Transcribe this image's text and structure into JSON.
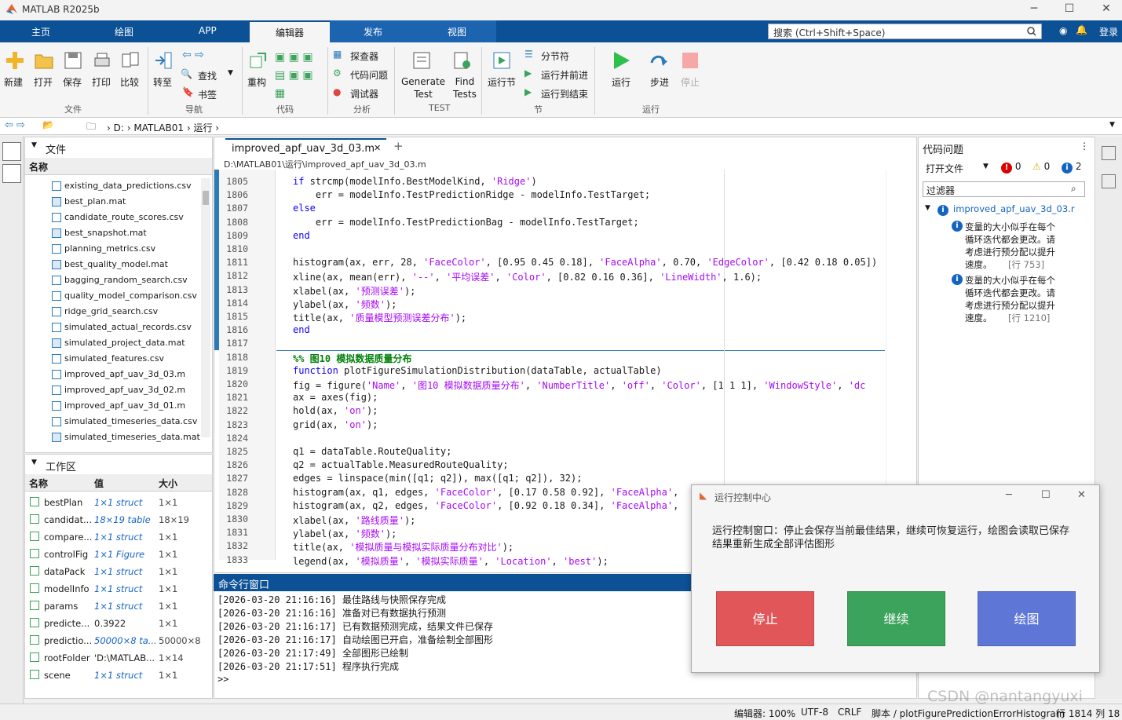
{
  "window": {
    "title": "MATLAB R2025b"
  },
  "tabs": [
    "主页",
    "绘图",
    "APP",
    "编辑器",
    "发布",
    "视图"
  ],
  "search": {
    "placeholder": "搜索 (Ctrl+Shift+Space)",
    "login": "登录"
  },
  "ribbon": {
    "file": {
      "new": "新建",
      "open": "打开",
      "save": "保存",
      "print": "打印",
      "compare": "比较",
      "group": "文件"
    },
    "nav": {
      "goto": "转至",
      "find": "查找",
      "bookmark": "书签",
      "group": "导航"
    },
    "code": {
      "refactor": "重构",
      "group": "代码"
    },
    "analyze": {
      "explorer": "探查器",
      "issues": "代码问题",
      "debugger": "调试器",
      "group": "分析"
    },
    "test": {
      "gen1": "Generate",
      "gen2": "Test",
      "find1": "Find",
      "find2": "Tests",
      "group": "TEST"
    },
    "section": {
      "run_section": "运行节",
      "break": "分节符",
      "run_advance": "运行并前进",
      "run_to_end": "运行到结束",
      "group": "节"
    },
    "run": {
      "run": "运行",
      "step": "步进",
      "stop": "停止",
      "group": "运行"
    }
  },
  "address": {
    "drive": "D:",
    "folder1": "MATLAB01",
    "folder2": "运行"
  },
  "files_panel": {
    "title": "文件",
    "col_name": "名称",
    "items": [
      "existing_data_predictions.csv",
      "best_plan.mat",
      "candidate_route_scores.csv",
      "best_snapshot.mat",
      "planning_metrics.csv",
      "best_quality_model.mat",
      "bagging_random_search.csv",
      "quality_model_comparison.csv",
      "ridge_grid_search.csv",
      "simulated_actual_records.csv",
      "simulated_project_data.mat",
      "simulated_features.csv",
      "improved_apf_uav_3d_03.m",
      "improved_apf_uav_3d_02.m",
      "improved_apf_uav_3d_01.m",
      "simulated_timeseries_data.csv",
      "simulated_timeseries_data.mat"
    ]
  },
  "workspace": {
    "title": "工作区",
    "col_name": "名称",
    "col_value": "值",
    "col_size": "大小",
    "rows": [
      {
        "name": "bestPlan",
        "value": "1×1 struct",
        "size": "1×1"
      },
      {
        "name": "candidat...",
        "value": "18×19 table",
        "size": "18×19"
      },
      {
        "name": "compare...",
        "value": "1×1 struct",
        "size": "1×1"
      },
      {
        "name": "controlFig",
        "value": "1×1 Figure",
        "size": "1×1"
      },
      {
        "name": "dataPack",
        "value": "1×1 struct",
        "size": "1×1"
      },
      {
        "name": "modelInfo",
        "value": "1×1 struct",
        "size": "1×1"
      },
      {
        "name": "params",
        "value": "1×1 struct",
        "size": "1×1"
      },
      {
        "name": "predicte...",
        "value": "0.3922",
        "size": "1×1"
      },
      {
        "name": "predictio...",
        "value": "50000×8 ta...",
        "size": "50000×8"
      },
      {
        "name": "rootFolder",
        "value": "'D:\\MATLAB...",
        "size": "1×14"
      },
      {
        "name": "scene",
        "value": "1×1 struct",
        "size": "1×1"
      }
    ]
  },
  "editor": {
    "tab": "improved_apf_uav_3d_03.m",
    "path": "D:\\MATLAB01\\运行\\improved_apf_uav_3d_03.m",
    "lines": [
      {
        "n": "1805",
        "html": "<span class=\"kw\">if</span> strcmp(modelInfo.BestModelKind, <span class=\"st\">'Ridge'</span>)"
      },
      {
        "n": "1806",
        "html": "    err = modelInfo.TestPredictionRidge - modelInfo.TestTarget;"
      },
      {
        "n": "1807",
        "html": "<span class=\"kw\">else</span>"
      },
      {
        "n": "1808",
        "html": "    err = modelInfo.TestPredictionBag - modelInfo.TestTarget;"
      },
      {
        "n": "1809",
        "html": "<span class=\"kw\">end</span>"
      },
      {
        "n": "1810",
        "html": ""
      },
      {
        "n": "1811",
        "html": "histogram(ax, err, 28, <span class=\"st\">'FaceColor'</span>, [0.95 0.45 0.18], <span class=\"st\">'FaceAlpha'</span>, 0.70, <span class=\"st\">'EdgeColor'</span>, [0.42 0.18 0.05])"
      },
      {
        "n": "1812",
        "html": "xline(ax, mean(err), <span class=\"st\">'--'</span>, <span class=\"st\">'平均误差'</span>, <span class=\"st\">'Color'</span>, [0.82 0.16 0.36], <span class=\"st\">'LineWidth'</span>, 1.6);"
      },
      {
        "n": "1813",
        "html": "xlabel(ax, <span class=\"st\">'预测误差'</span>);"
      },
      {
        "n": "1814",
        "html": "ylabel(ax, <span class=\"st\">'频数'</span>);"
      },
      {
        "n": "1815",
        "html": "title(ax, <span class=\"st\">'质量模型预测误差分布'</span>);"
      },
      {
        "n": "1816",
        "html": "<span class=\"kw\">end</span>"
      },
      {
        "n": "1817",
        "html": ""
      },
      {
        "n": "1818",
        "html": "<span class=\"cm\">%% 图10 模拟数据质量分布</span>"
      },
      {
        "n": "1819",
        "html": "<span class=\"kw\">function</span> plotFigureSimulationDistribution(dataTable, actualTable)"
      },
      {
        "n": "1820",
        "html": "fig = figure(<span class=\"st\">'Name'</span>, <span class=\"st\">'图10 模拟数据质量分布'</span>, <span class=\"st\">'NumberTitle'</span>, <span class=\"st\">'off'</span>, <span class=\"st\">'Color'</span>, [1 1 1], <span class=\"st\">'WindowStyle'</span>, <span class=\"st\">'dc</span>"
      },
      {
        "n": "1821",
        "html": "ax = axes(fig);"
      },
      {
        "n": "1822",
        "html": "hold(ax, <span class=\"st\">'on'</span>);"
      },
      {
        "n": "1823",
        "html": "grid(ax, <span class=\"st\">'on'</span>);"
      },
      {
        "n": "1824",
        "html": ""
      },
      {
        "n": "1825",
        "html": "q1 = dataTable.RouteQuality;"
      },
      {
        "n": "1826",
        "html": "q2 = actualTable.MeasuredRouteQuality;"
      },
      {
        "n": "1827",
        "html": "edges = linspace(min([q1; q2]), max([q1; q2]), 32);"
      },
      {
        "n": "1828",
        "html": "histogram(ax, q1, edges, <span class=\"st\">'FaceColor'</span>, [0.17 0.58 0.92], <span class=\"st\">'FaceAlpha'</span>,"
      },
      {
        "n": "1829",
        "html": "histogram(ax, q2, edges, <span class=\"st\">'FaceColor'</span>, [0.92 0.18 0.34], <span class=\"st\">'FaceAlpha'</span>,"
      },
      {
        "n": "1830",
        "html": "xlabel(ax, <span class=\"st\">'路线质量'</span>);"
      },
      {
        "n": "1831",
        "html": "ylabel(ax, <span class=\"st\">'频数'</span>);"
      },
      {
        "n": "1832",
        "html": "title(ax, <span class=\"st\">'模拟质量与模拟实际质量分布对比'</span>);"
      },
      {
        "n": "1833",
        "html": "legend(ax, <span class=\"st\">'模拟质量'</span>, <span class=\"st\">'模拟实际质量'</span>, <span class=\"st\">'Location'</span>, <span class=\"st\">'best'</span>);"
      }
    ]
  },
  "command_window": {
    "title": "命令行窗口",
    "lines": [
      "[2026-03-20 21:16:16] 最佳路线与快照保存完成",
      "[2026-03-20 21:16:16] 准备对已有数据执行预测",
      "[2026-03-20 21:16:17] 已有数据预测完成，结果文件已保存",
      "[2026-03-20 21:16:17] 自动绘图已开启，准备绘制全部图形",
      "[2026-03-20 21:17:49] 全部图形已绘制",
      "[2026-03-20 21:17:51] 程序执行完成"
    ],
    "prompt": ">>"
  },
  "issues_panel": {
    "title": "代码问题",
    "scope": "打开文件",
    "err_count": "0",
    "warn_count": "0",
    "info_count": "2",
    "filter_placeholder": "过滤器",
    "file": "improved_apf_uav_3d_03.r",
    "items": [
      {
        "l1": "变量的大小似乎在每个",
        "l2": "循环迭代都会更改。请",
        "l3": "考虑进行预分配以提升",
        "l4": "速度。",
        "line": "[行 753]"
      },
      {
        "l1": "变量的大小似乎在每个",
        "l2": "循环迭代都会更改。请",
        "l3": "考虑进行预分配以提升",
        "l4": "速度。",
        "line": "[行 1210]"
      }
    ]
  },
  "dialog": {
    "title": "运行控制中心",
    "message1": "运行控制窗口：停止会保存当前最佳结果，继续可恢复运行，绘图会读取已保存",
    "message2": "结果重新生成全部评估图形",
    "stop": "停止",
    "continue": "继续",
    "plot": "绘图",
    "colors": {
      "stop": "#e15759",
      "continue": "#3ba35b",
      "plot": "#5e76d6"
    }
  },
  "status": {
    "zoom": "编辑器: 100%",
    "encoding": "UTF-8",
    "eol": "CRLF",
    "script": "脚本 / plotFigurePredictionErrorHistogram",
    "pos": "行 1814 列 18",
    "watermark": "CSDN @nantangyuxi"
  }
}
